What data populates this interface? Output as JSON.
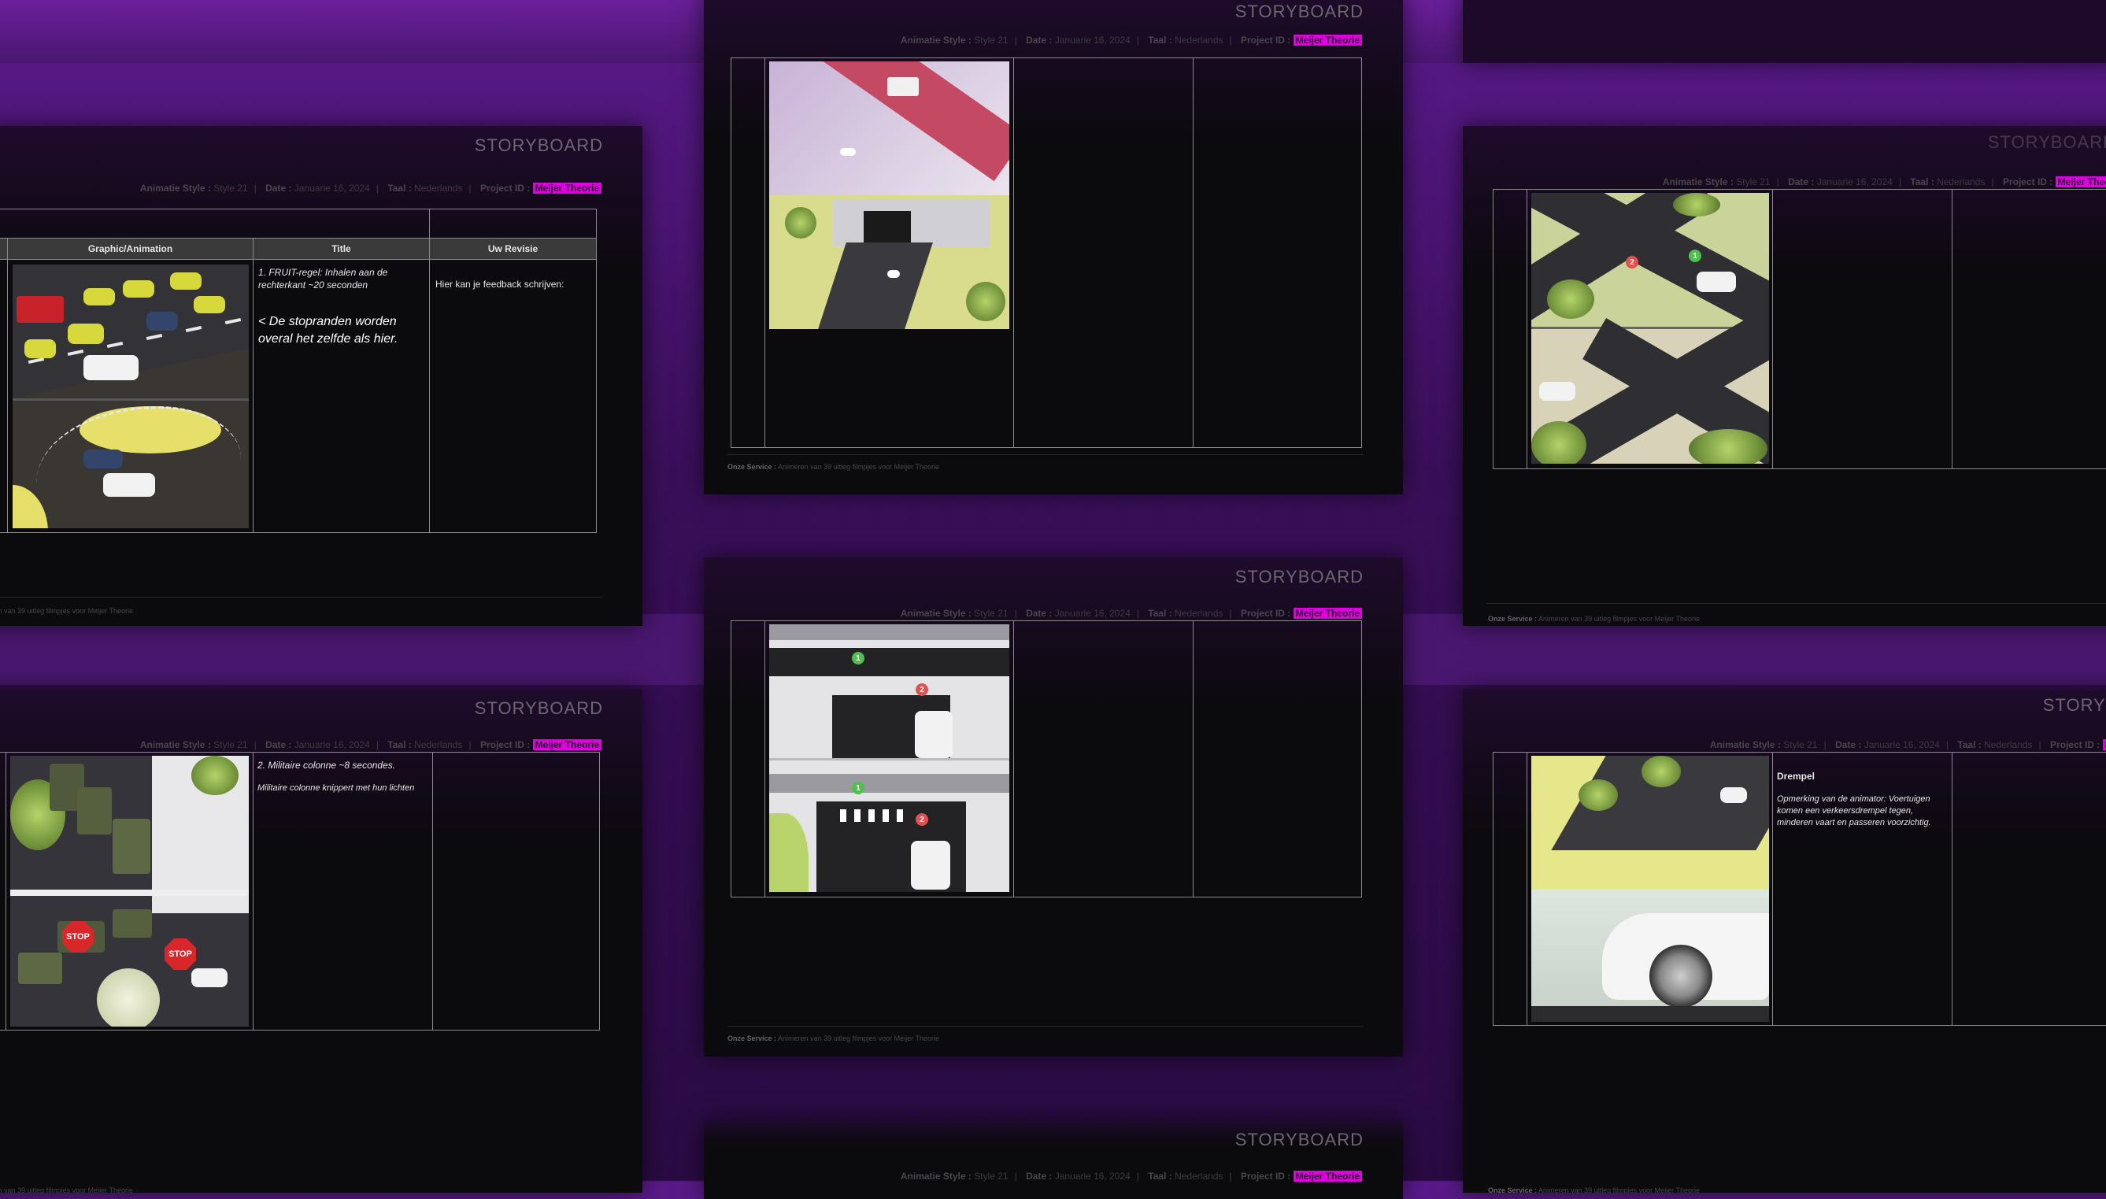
{
  "card_title": "STORYBOARD",
  "meta": {
    "style_label": "Animatie Style :",
    "style_value": "Style 21",
    "date_label": "Date :",
    "date_value": "Januarie 16, 2024",
    "lang_label": "Taal :",
    "lang_value": "Nederlands",
    "project_label": "Project ID :",
    "project_value": "Meijer Theorie"
  },
  "footer": {
    "label": "Onze Service :",
    "value": "Animeren van 39 uitleg filmpjes voor Meijer Theorie"
  },
  "table_headers": {
    "graphic": "Graphic/Animation",
    "title": "Title",
    "revision": "Uw Revisie"
  },
  "scenes": {
    "fruit_title": "1. FRUIT-regel: Inhalen aan de rechterkant ~20 seconden",
    "fruit_note": "< De stopranden worden overal het zelfde als hier.",
    "fruit_feedback": "Hier kan je feedback schrijven:",
    "military_title": "2. Militaire colonne ~8 secondes.",
    "military_desc": "Militaire colonne knippert met hun lichten",
    "drempel_title": "Drempel",
    "drempel_desc": "Opmerking van de animator: Voertuigen komen een verkeersdrempel tegen, minderen vaart en passeren voorzichtig."
  },
  "icons": {
    "stop_sign": "STOP",
    "marker_green": "1",
    "marker_red": "2"
  },
  "colors": {
    "accent_magenta": "#e000e0",
    "background_purple": "#4a1770",
    "card_dark": "#0b0a0d"
  }
}
